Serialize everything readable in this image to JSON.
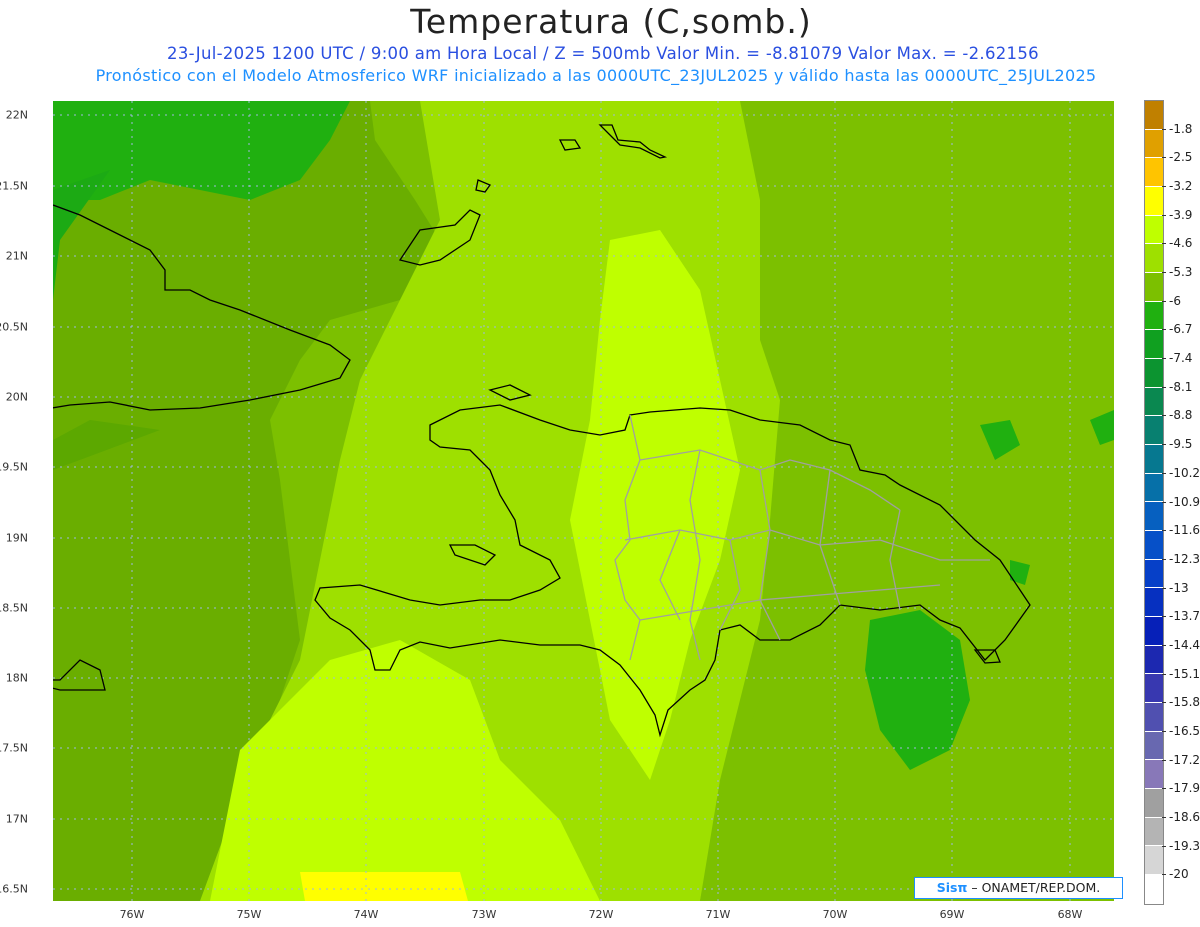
{
  "title": "Temperatura (C,somb.)",
  "subtitle_line1": "23-Jul-2025   1200 UTC / 9:00 am Hora Local / Z = 500mb  Valor Min. = -8.81079  Valor Max. = -2.62156",
  "subtitle_line2": "Pronóstico con el Modelo Atmosferico WRF inicializado a las 0000UTC_23JUL2025 y válido hasta las  0000UTC_25JUL2025",
  "colors": {
    "title": "#222222",
    "subtitle1": "#2a4fe0",
    "subtitle2": "#1e90ff",
    "coast": "#000000",
    "province_borders": "#a0a0a0",
    "gridlines": "#9fb8e0"
  },
  "map": {
    "lat_labels": [
      "22N",
      "21.5N",
      "21N",
      "20.5N",
      "20N",
      "19.5N",
      "19N",
      "18.5N",
      "18N",
      "17.5N",
      "17N",
      "16.5N"
    ],
    "lon_labels": [
      "76W",
      "75W",
      "74W",
      "73W",
      "72W",
      "71W",
      "70W",
      "69W",
      "68W"
    ]
  },
  "colorbar": {
    "labels": [
      "-1.8",
      "-2.5",
      "-3.2",
      "-3.9",
      "-4.6",
      "-5.3",
      "-6",
      "-6.7",
      "-7.4",
      "-8.1",
      "-8.8",
      "-9.5",
      "-10.2",
      "-10.9",
      "-11.6",
      "-12.3",
      "-13",
      "-13.7",
      "-14.4",
      "-15.1",
      "-15.8",
      "-16.5",
      "-17.2",
      "-17.9",
      "-18.6",
      "-19.3",
      "-20"
    ],
    "colors": [
      "#c08000",
      "#e0a000",
      "#ffc400",
      "#ffff00",
      "#bfff00",
      "#9ee000",
      "#7cc000",
      "#20b010",
      "#10a020",
      "#0c9430",
      "#0a8850",
      "#088070",
      "#067890",
      "#0670a8",
      "#0660c0",
      "#0650c8",
      "#0640c8",
      "#0630c0",
      "#0620b8",
      "#1c28b0",
      "#3838b0",
      "#5050b0",
      "#6868b0",
      "#8878b8",
      "#a0a0a0",
      "#b4b4b4",
      "#d6d6d6",
      "#ffffff"
    ]
  },
  "credit": {
    "sis": "Sisπ",
    "text": " – ONAMET/REP.DOM."
  }
}
